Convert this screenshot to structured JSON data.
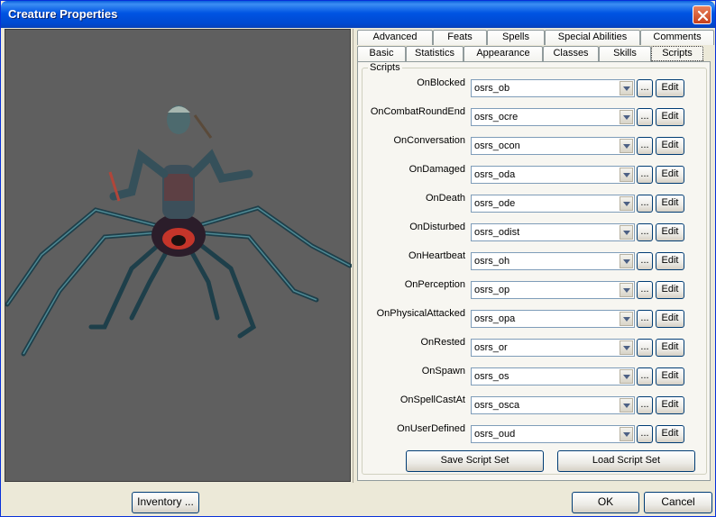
{
  "window": {
    "title": "Creature Properties"
  },
  "tabs": {
    "row1": [
      "Advanced",
      "Feats",
      "Spells",
      "Special Abilities",
      "Comments"
    ],
    "row2": [
      "Basic",
      "Statistics",
      "Appearance",
      "Classes",
      "Skills",
      "Scripts"
    ],
    "active": "Scripts"
  },
  "scripts": {
    "group_label": "Scripts",
    "browse_label": "...",
    "edit_label": "Edit",
    "rows": [
      {
        "event": "OnBlocked",
        "value": "osrs_ob"
      },
      {
        "event": "OnCombatRoundEnd",
        "value": "osrs_ocre"
      },
      {
        "event": "OnConversation",
        "value": "osrs_ocon"
      },
      {
        "event": "OnDamaged",
        "value": "osrs_oda"
      },
      {
        "event": "OnDeath",
        "value": "osrs_ode"
      },
      {
        "event": "OnDisturbed",
        "value": "osrs_odist"
      },
      {
        "event": "OnHeartbeat",
        "value": "osrs_oh"
      },
      {
        "event": "OnPerception",
        "value": "osrs_op"
      },
      {
        "event": "OnPhysicalAttacked",
        "value": "osrs_opa"
      },
      {
        "event": "OnRested",
        "value": "osrs_or"
      },
      {
        "event": "OnSpawn",
        "value": "osrs_os"
      },
      {
        "event": "OnSpellCastAt",
        "value": "osrs_osca"
      },
      {
        "event": "OnUserDefined",
        "value": "osrs_oud"
      }
    ],
    "save_set_label": "Save Script Set",
    "load_set_label": "Load Script Set"
  },
  "footer": {
    "inventory_label": "Inventory ...",
    "ok_label": "OK",
    "cancel_label": "Cancel"
  },
  "colors": {
    "title_bar": "#0054e3",
    "viewport_bg": "#5f5f5f",
    "dialog_bg": "#ece9d8"
  }
}
